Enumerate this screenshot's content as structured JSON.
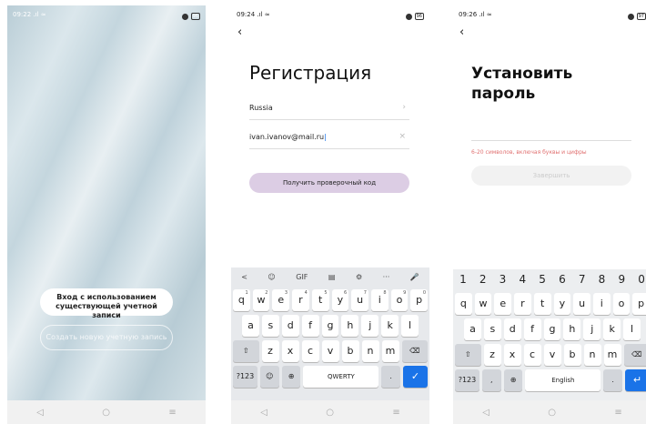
{
  "screen1": {
    "status": {
      "time": "09:22",
      "battery": "96"
    },
    "login_button": "Вход с использованием существующей учетной записи",
    "create_button": "Создать новую учетную запись"
  },
  "screen2": {
    "status": {
      "time": "09:24",
      "battery": "96"
    },
    "title": "Регистрация",
    "country": "Russia",
    "email": "ivan.ivanov@mail.ru",
    "get_code_button": "Получить проверочный код",
    "keyboard": {
      "tools": [
        "<",
        "☺",
        "GIF",
        "▤",
        "⚙",
        "···",
        "🎤"
      ],
      "row1": [
        "q",
        "w",
        "e",
        "r",
        "t",
        "y",
        "u",
        "i",
        "o",
        "p"
      ],
      "row1_nums": [
        "1",
        "2",
        "3",
        "4",
        "5",
        "6",
        "7",
        "8",
        "9",
        "0"
      ],
      "row2": [
        "a",
        "s",
        "d",
        "f",
        "g",
        "h",
        "j",
        "k",
        "l"
      ],
      "row3": [
        "z",
        "x",
        "c",
        "v",
        "b",
        "n",
        "m"
      ],
      "sym": "?123",
      "space": "QWERTY"
    }
  },
  "screen3": {
    "status": {
      "time": "09:26",
      "battery": "97"
    },
    "title_line1": "Установить",
    "title_line2": "пароль",
    "hint": "6-20 символов, включая буквы и цифры",
    "finish_button": "Завершить",
    "keyboard": {
      "numbers": [
        "1",
        "2",
        "3",
        "4",
        "5",
        "6",
        "7",
        "8",
        "9",
        "0"
      ],
      "row1": [
        "q",
        "w",
        "e",
        "r",
        "t",
        "y",
        "u",
        "i",
        "o",
        "p"
      ],
      "row2": [
        "a",
        "s",
        "d",
        "f",
        "g",
        "h",
        "j",
        "k",
        "l"
      ],
      "row3": [
        "z",
        "x",
        "c",
        "v",
        "b",
        "n",
        "m"
      ],
      "sym": "?123",
      "comma": ",",
      "space": "English",
      "period": "."
    }
  },
  "nav": {
    "back": "◁",
    "home": "○",
    "menu": "≡"
  }
}
